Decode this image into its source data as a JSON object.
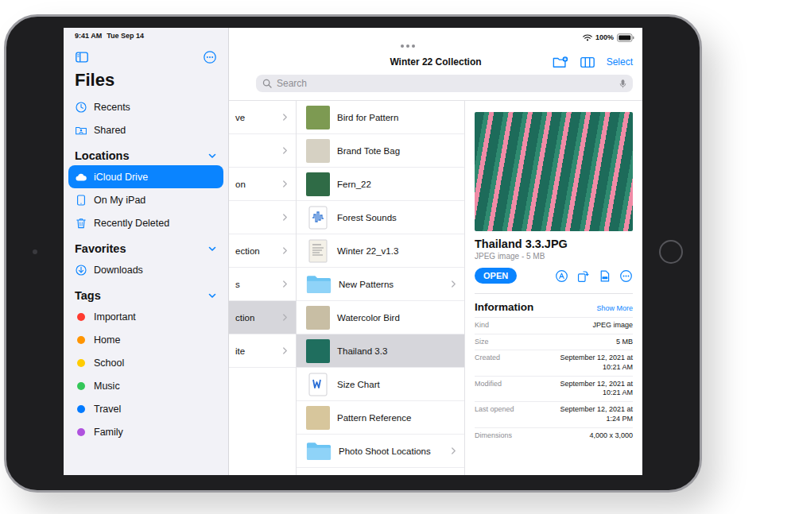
{
  "status_bar": {
    "time": "9:41 AM",
    "date": "Tue Sep 14",
    "battery": "100%",
    "level": 1
  },
  "sidebar": {
    "title": "Files",
    "items": [
      {
        "label": "Recents",
        "kind": "clock",
        "selected": false
      },
      {
        "label": "Shared",
        "kind": "shared",
        "selected": false
      }
    ],
    "sections": [
      {
        "title": "Locations",
        "expanded": true,
        "items": [
          {
            "label": "iCloud Drive",
            "kind": "cloud",
            "selected": true
          },
          {
            "label": "On My iPad",
            "kind": "ipad",
            "selected": false
          },
          {
            "label": "Recently Deleted",
            "kind": "trash",
            "selected": false
          }
        ]
      },
      {
        "title": "Favorites",
        "expanded": true,
        "items": [
          {
            "label": "Downloads",
            "kind": "download",
            "selected": false
          }
        ]
      },
      {
        "title": "Tags",
        "expanded": true,
        "items": [
          {
            "label": "Important",
            "kind": "tag",
            "color": "#ff3b30",
            "selected": false
          },
          {
            "label": "Home",
            "kind": "tag",
            "color": "#ff9500",
            "selected": false
          },
          {
            "label": "School",
            "kind": "tag",
            "color": "#ffcc00",
            "selected": false
          },
          {
            "label": "Music",
            "kind": "tag",
            "color": "#34c759",
            "selected": false
          },
          {
            "label": "Travel",
            "kind": "tag",
            "color": "#007aff",
            "selected": false
          },
          {
            "label": "Family",
            "kind": "tag",
            "color": "#af52de",
            "selected": false
          }
        ]
      }
    ]
  },
  "toolbar": {
    "title": "Winter 22 Collection",
    "action": "Select"
  },
  "search": {
    "placeholder": "Search"
  },
  "parent_column": [
    {
      "label": "ve",
      "selected": false
    },
    {
      "label": "",
      "selected": false
    },
    {
      "label": "on",
      "selected": false
    },
    {
      "label": "",
      "selected": false
    },
    {
      "label": "ection",
      "selected": false
    },
    {
      "label": "s",
      "selected": false
    },
    {
      "label": "ction",
      "selected": true
    },
    {
      "label": "ite",
      "selected": false
    }
  ],
  "files": [
    {
      "name": "Bird for Pattern",
      "kind": "image",
      "color": "#7d9a52",
      "selected": false
    },
    {
      "name": "Brand Tote Bag",
      "kind": "image",
      "color": "#d6d1c3",
      "selected": false
    },
    {
      "name": "Fern_22",
      "kind": "image",
      "color": "#2f6b46",
      "selected": false
    },
    {
      "name": "Forest Sounds",
      "kind": "audio",
      "selected": false
    },
    {
      "name": "Winter 22_v1.3",
      "kind": "document",
      "selected": false
    },
    {
      "name": "New Patterns",
      "kind": "folder",
      "selected": false
    },
    {
      "name": "Watercolor Bird",
      "kind": "image",
      "color": "#c8bea4",
      "selected": false
    },
    {
      "name": "Thailand 3.3",
      "kind": "image",
      "color": "#1f6e5e",
      "selected": true
    },
    {
      "name": "Size Chart",
      "kind": "word",
      "selected": false
    },
    {
      "name": "Pattern Reference",
      "kind": "image",
      "color": "#d7c69c",
      "selected": false
    },
    {
      "name": "Photo Shoot Locations",
      "kind": "folder",
      "selected": false
    }
  ],
  "preview": {
    "name": "Thailand 3.3.JPG",
    "subtitle": "JPEG image - 5 MB",
    "open": "OPEN",
    "info_title": "Information",
    "show_more": "Show More",
    "info": [
      {
        "label": "Kind",
        "value": "JPEG image"
      },
      {
        "label": "Size",
        "value": "5 MB"
      },
      {
        "label": "Created",
        "value": "September 12, 2021 at 10:21 AM"
      },
      {
        "label": "Modified",
        "value": "September 12, 2021 at 10:21 AM"
      },
      {
        "label": "Last opened",
        "value": "September 12, 2021 at 1:24 PM"
      },
      {
        "label": "Dimensions",
        "value": "4,000 x 3,000"
      }
    ]
  }
}
